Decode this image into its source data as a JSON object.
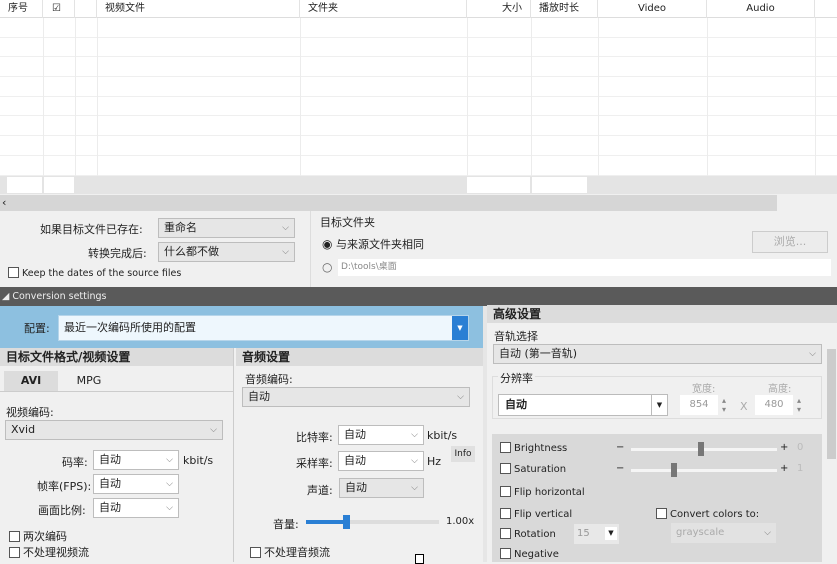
{
  "table": {
    "columns": [
      "序号",
      "☑",
      "",
      "视频文件",
      "文件夹",
      "大小",
      "播放时长",
      "Video",
      "Audio"
    ]
  },
  "options": {
    "if_exists_label": "如果目标文件已存在:",
    "if_exists_value": "重命名",
    "after_label": "转换完成后:",
    "after_value": "什么都不做",
    "keep_dates": "Keep the dates of the source files",
    "target_folder_label": "目标文件夹",
    "same_as_source": "与来源文件夹相同",
    "custom_path": "D:\\tools\\桌面",
    "browse": "浏览..."
  },
  "conversion_settings": "Conversion settings",
  "config": {
    "label": "配置:",
    "value": "最近一次编码所使用的配置"
  },
  "video": {
    "title": "目标文件格式/视频设置",
    "tabs": [
      "AVI",
      "MPG"
    ],
    "codec_label": "视频编码:",
    "codec": "Xvid",
    "bitrate_label": "码率:",
    "bitrate": "自动",
    "bitrate_unit": "kbit/s",
    "fps_label": "帧率(FPS):",
    "fps": "自动",
    "aspect_label": "画面比例:",
    "aspect": "自动",
    "two_pass": "两次编码",
    "no_video": "不处理视频流"
  },
  "audio": {
    "title": "音频设置",
    "codec_label": "音频编码:",
    "codec": "自动",
    "bitrate_label": "比特率:",
    "bitrate": "自动",
    "bitrate_unit": "kbit/s",
    "sample_label": "采样率:",
    "sample": "自动",
    "sample_unit": "Hz",
    "info": "Info",
    "channels_label": "声道:",
    "channels": "自动",
    "volume_label": "音量:",
    "volume": "1.00x",
    "volume_fraction": 0.3,
    "no_audio": "不处理音频流"
  },
  "advanced": {
    "title": "高级设置",
    "track_label": "音轨选择",
    "track": "自动 (第一音轨)",
    "resolution_label": "分辨率",
    "resolution": "自动",
    "width_label": "宽度:",
    "width": "854",
    "x": "X",
    "height_label": "高度:",
    "height": "480",
    "brightness": "Brightness",
    "brightness_value": "0",
    "saturation": "Saturation",
    "saturation_value": "1",
    "flip_h": "Flip horizontal",
    "flip_v": "Flip vertical",
    "convert_colors": "Convert colors to:",
    "color_mode": "grayscale",
    "rotation": "Rotation",
    "rotation_value": "15",
    "negative": "Negative"
  }
}
